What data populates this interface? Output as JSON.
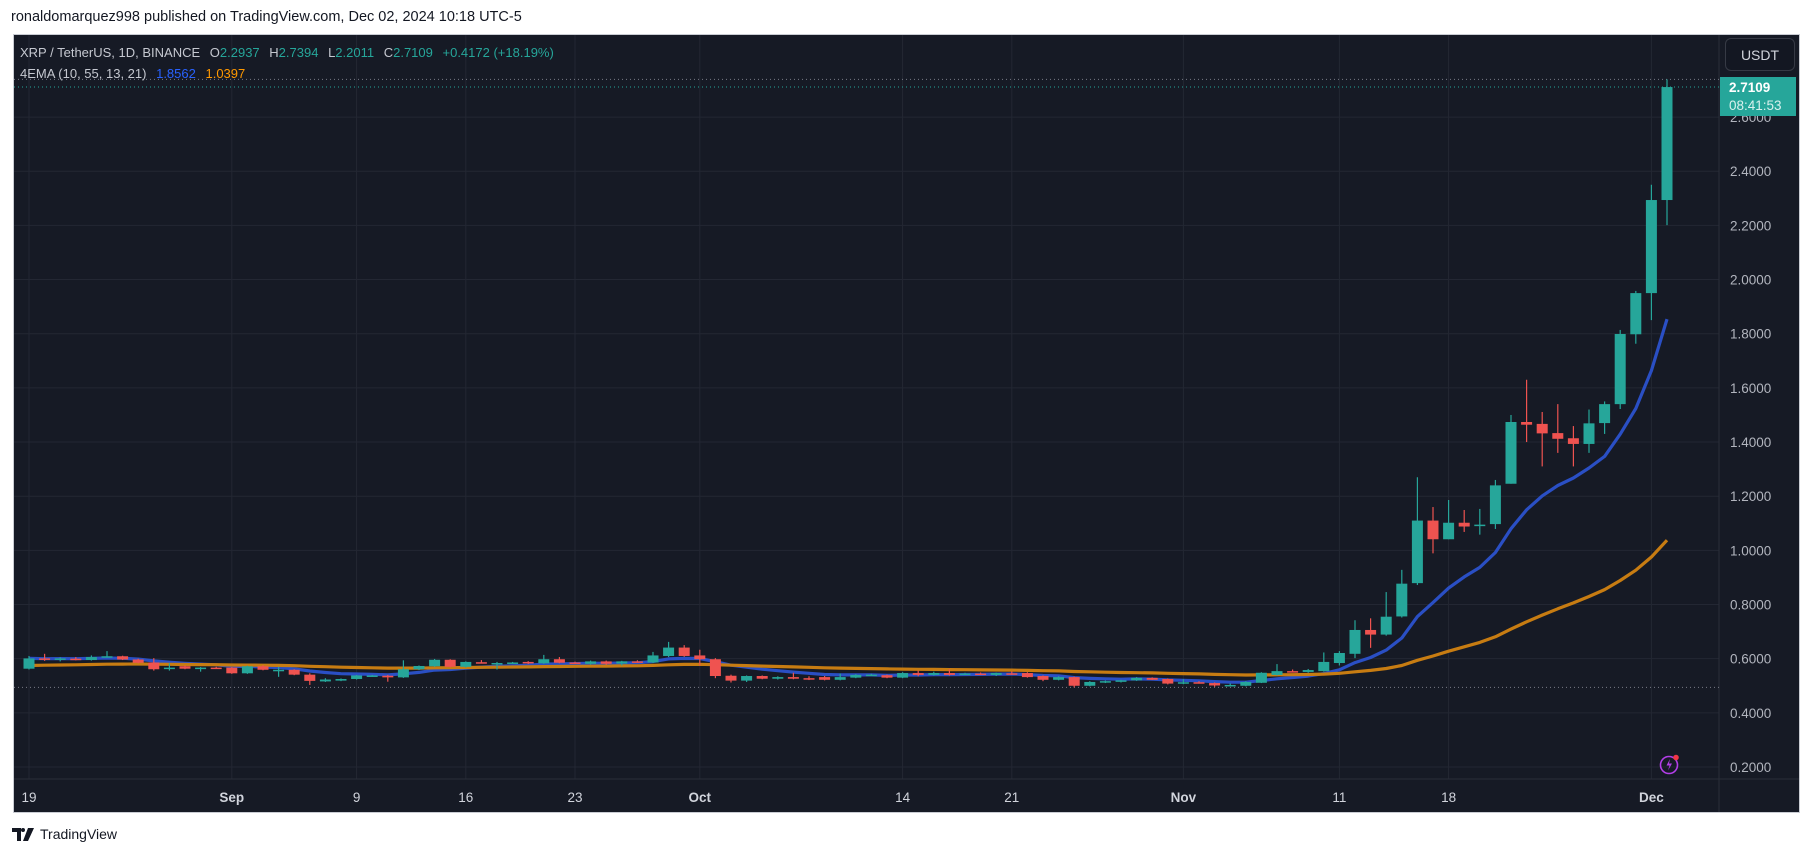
{
  "header": {
    "published": "ronaldomarquez998 published on TradingView.com, Dec 02, 2024 10:18 UTC-5"
  },
  "legend": {
    "symbol": "XRP / TetherUS, 1D, BINANCE",
    "o_label": "O",
    "o": "2.2937",
    "h_label": "H",
    "h": "2.7394",
    "l_label": "L",
    "l": "2.2011",
    "c_label": "C",
    "c": "2.7109",
    "change": "+0.4172 (+18.19%)",
    "indicator": "4EMA (10, 55, 13, 21)",
    "ema1": "1.8562",
    "ema2": "1.0397"
  },
  "price_axis": {
    "currency": "USDT",
    "last_price": "2.7109",
    "countdown": "08:41:53"
  },
  "footer": {
    "brand": "TradingView"
  },
  "icons": {
    "alert": "lightning-icon",
    "logo": "tradingview-logo"
  },
  "colors": {
    "up": "#26a69a",
    "down": "#ef5350",
    "ema_fast": "#2a4fc4",
    "ema_slow": "#c77c12",
    "background": "#161a25",
    "grid": "#232733"
  },
  "chart_data": {
    "type": "candlestick",
    "title": "XRP / TetherUS, 1D, BINANCE",
    "x_start": "2024-08-19",
    "ylim": [
      0.1,
      2.9
    ],
    "y_ticks": [
      "0.2000",
      "0.4000",
      "0.6000",
      "0.8000",
      "1.0000",
      "1.2000",
      "1.4000",
      "1.6000",
      "1.8000",
      "2.0000",
      "2.2000",
      "2.4000",
      "2.6000"
    ],
    "x_ticks": [
      {
        "label": "19",
        "index": 0,
        "bold": false
      },
      {
        "label": "Sep",
        "index": 13,
        "bold": true
      },
      {
        "label": "9",
        "index": 21,
        "bold": false
      },
      {
        "label": "16",
        "index": 28,
        "bold": false
      },
      {
        "label": "23",
        "index": 35,
        "bold": false
      },
      {
        "label": "Oct",
        "index": 43,
        "bold": true
      },
      {
        "label": "14",
        "index": 56,
        "bold": false
      },
      {
        "label": "21",
        "index": 63,
        "bold": false
      },
      {
        "label": "Nov",
        "index": 74,
        "bold": true
      },
      {
        "label": "11",
        "index": 84,
        "bold": false
      },
      {
        "label": "18",
        "index": 91,
        "bold": false
      },
      {
        "label": "Dec",
        "index": 104,
        "bold": true
      }
    ],
    "ema_periods": [
      10,
      55
    ],
    "ohlc": [
      [
        0.563,
        0.61,
        0.56,
        0.601
      ],
      [
        0.601,
        0.618,
        0.592,
        0.596
      ],
      [
        0.596,
        0.605,
        0.59,
        0.601
      ],
      [
        0.6,
        0.606,
        0.594,
        0.598
      ],
      [
        0.595,
        0.612,
        0.593,
        0.606
      ],
      [
        0.607,
        0.628,
        0.604,
        0.609
      ],
      [
        0.609,
        0.611,
        0.595,
        0.597
      ],
      [
        0.597,
        0.6,
        0.583,
        0.585
      ],
      [
        0.586,
        0.602,
        0.556,
        0.561
      ],
      [
        0.565,
        0.583,
        0.556,
        0.567
      ],
      [
        0.572,
        0.575,
        0.561,
        0.563
      ],
      [
        0.562,
        0.569,
        0.552,
        0.567
      ],
      [
        0.567,
        0.57,
        0.563,
        0.566
      ],
      [
        0.567,
        0.569,
        0.544,
        0.546
      ],
      [
        0.546,
        0.574,
        0.544,
        0.572
      ],
      [
        0.572,
        0.576,
        0.557,
        0.559
      ],
      [
        0.557,
        0.57,
        0.533,
        0.559
      ],
      [
        0.559,
        0.561,
        0.539,
        0.541
      ],
      [
        0.541,
        0.546,
        0.503,
        0.518
      ],
      [
        0.516,
        0.528,
        0.514,
        0.523
      ],
      [
        0.519,
        0.527,
        0.517,
        0.525
      ],
      [
        0.525,
        0.54,
        0.523,
        0.538
      ],
      [
        0.536,
        0.54,
        0.533,
        0.538
      ],
      [
        0.537,
        0.54,
        0.515,
        0.531
      ],
      [
        0.531,
        0.594,
        0.529,
        0.561
      ],
      [
        0.561,
        0.575,
        0.558,
        0.573
      ],
      [
        0.572,
        0.599,
        0.57,
        0.596
      ],
      [
        0.596,
        0.598,
        0.568,
        0.57
      ],
      [
        0.57,
        0.59,
        0.567,
        0.588
      ],
      [
        0.587,
        0.595,
        0.584,
        0.586
      ],
      [
        0.582,
        0.588,
        0.56,
        0.584
      ],
      [
        0.584,
        0.588,
        0.581,
        0.586
      ],
      [
        0.588,
        0.591,
        0.58,
        0.584
      ],
      [
        0.583,
        0.614,
        0.581,
        0.598
      ],
      [
        0.598,
        0.606,
        0.583,
        0.585
      ],
      [
        0.586,
        0.589,
        0.583,
        0.585
      ],
      [
        0.581,
        0.593,
        0.578,
        0.59
      ],
      [
        0.59,
        0.593,
        0.578,
        0.581
      ],
      [
        0.582,
        0.592,
        0.575,
        0.59
      ],
      [
        0.59,
        0.594,
        0.585,
        0.588
      ],
      [
        0.586,
        0.625,
        0.584,
        0.612
      ],
      [
        0.61,
        0.662,
        0.606,
        0.641
      ],
      [
        0.641,
        0.65,
        0.607,
        0.61
      ],
      [
        0.612,
        0.633,
        0.575,
        0.598
      ],
      [
        0.598,
        0.602,
        0.528,
        0.536
      ],
      [
        0.537,
        0.541,
        0.512,
        0.519
      ],
      [
        0.519,
        0.538,
        0.514,
        0.536
      ],
      [
        0.536,
        0.538,
        0.524,
        0.526
      ],
      [
        0.526,
        0.535,
        0.523,
        0.532
      ],
      [
        0.532,
        0.548,
        0.524,
        0.526
      ],
      [
        0.528,
        0.535,
        0.521,
        0.527
      ],
      [
        0.532,
        0.536,
        0.52,
        0.522
      ],
      [
        0.522,
        0.545,
        0.52,
        0.532
      ],
      [
        0.53,
        0.543,
        0.528,
        0.54
      ],
      [
        0.54,
        0.544,
        0.537,
        0.541
      ],
      [
        0.539,
        0.541,
        0.528,
        0.53
      ],
      [
        0.53,
        0.55,
        0.528,
        0.547
      ],
      [
        0.547,
        0.556,
        0.535,
        0.54
      ],
      [
        0.54,
        0.552,
        0.538,
        0.547
      ],
      [
        0.547,
        0.561,
        0.538,
        0.54
      ],
      [
        0.544,
        0.548,
        0.54,
        0.545
      ],
      [
        0.545,
        0.549,
        0.541,
        0.544
      ],
      [
        0.54,
        0.549,
        0.536,
        0.547
      ],
      [
        0.546,
        0.553,
        0.54,
        0.545
      ],
      [
        0.547,
        0.55,
        0.53,
        0.532
      ],
      [
        0.536,
        0.538,
        0.517,
        0.522
      ],
      [
        0.522,
        0.535,
        0.52,
        0.532
      ],
      [
        0.532,
        0.534,
        0.494,
        0.5
      ],
      [
        0.5,
        0.517,
        0.498,
        0.514
      ],
      [
        0.515,
        0.519,
        0.51,
        0.517
      ],
      [
        0.518,
        0.522,
        0.512,
        0.52
      ],
      [
        0.52,
        0.532,
        0.518,
        0.529
      ],
      [
        0.529,
        0.531,
        0.521,
        0.522
      ],
      [
        0.525,
        0.527,
        0.505,
        0.508
      ],
      [
        0.511,
        0.524,
        0.506,
        0.513
      ],
      [
        0.513,
        0.517,
        0.508,
        0.511
      ],
      [
        0.51,
        0.512,
        0.496,
        0.501
      ],
      [
        0.501,
        0.509,
        0.498,
        0.503
      ],
      [
        0.5,
        0.517,
        0.498,
        0.514
      ],
      [
        0.511,
        0.55,
        0.51,
        0.548
      ],
      [
        0.54,
        0.58,
        0.538,
        0.554
      ],
      [
        0.554,
        0.56,
        0.549,
        0.552
      ],
      [
        0.551,
        0.562,
        0.548,
        0.558
      ],
      [
        0.554,
        0.623,
        0.552,
        0.588
      ],
      [
        0.584,
        0.628,
        0.575,
        0.621
      ],
      [
        0.618,
        0.742,
        0.602,
        0.706
      ],
      [
        0.706,
        0.749,
        0.64,
        0.689
      ],
      [
        0.689,
        0.846,
        0.685,
        0.755
      ],
      [
        0.756,
        0.928,
        0.752,
        0.877
      ],
      [
        0.879,
        1.27,
        0.872,
        1.11
      ],
      [
        1.11,
        1.16,
        0.989,
        1.041
      ],
      [
        1.041,
        1.186,
        1.041,
        1.102
      ],
      [
        1.102,
        1.149,
        1.068,
        1.088
      ],
      [
        1.09,
        1.153,
        1.058,
        1.095
      ],
      [
        1.097,
        1.26,
        1.079,
        1.24
      ],
      [
        1.246,
        1.5,
        1.246,
        1.474
      ],
      [
        1.474,
        1.63,
        1.4,
        1.464
      ],
      [
        1.467,
        1.511,
        1.31,
        1.432
      ],
      [
        1.433,
        1.54,
        1.36,
        1.412
      ],
      [
        1.414,
        1.459,
        1.31,
        1.393
      ],
      [
        1.393,
        1.52,
        1.36,
        1.469
      ],
      [
        1.47,
        1.55,
        1.43,
        1.54
      ],
      [
        1.54,
        1.814,
        1.522,
        1.799
      ],
      [
        1.798,
        1.958,
        1.763,
        1.95
      ],
      [
        1.95,
        2.35,
        1.85,
        2.2937
      ],
      [
        2.2937,
        2.7394,
        2.2011,
        2.7109
      ]
    ]
  }
}
